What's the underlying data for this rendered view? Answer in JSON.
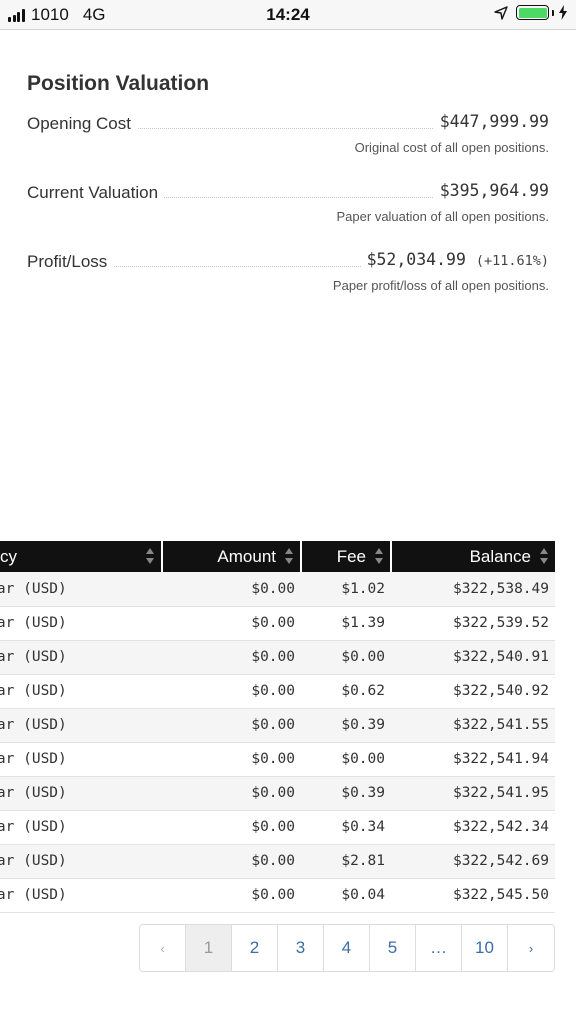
{
  "status_bar": {
    "carrier": "1010",
    "network": "4G",
    "time": "14:24"
  },
  "valuation": {
    "title": "Position Valuation",
    "rows": [
      {
        "label": "Opening Cost",
        "value": "$447,999.99",
        "pct": "",
        "note": "Original cost of all open positions."
      },
      {
        "label": "Current Valuation",
        "value": "$395,964.99",
        "pct": "",
        "note": "Paper valuation of all open positions."
      },
      {
        "label": "Profit/Loss",
        "value": "$52,034.99",
        "pct": "(+11.61%)",
        "note": "Paper profit/loss of all open positions."
      }
    ]
  },
  "table": {
    "headers": [
      "cy",
      "Amount",
      "Fee",
      "Balance"
    ],
    "rows": [
      {
        "currency": "Dollar (USD)",
        "amount": "$0.00",
        "fee": "$1.02",
        "balance": "$322,538.49"
      },
      {
        "currency": "Dollar (USD)",
        "amount": "$0.00",
        "fee": "$1.39",
        "balance": "$322,539.52"
      },
      {
        "currency": "Dollar (USD)",
        "amount": "$0.00",
        "fee": "$0.00",
        "balance": "$322,540.91"
      },
      {
        "currency": "Dollar (USD)",
        "amount": "$0.00",
        "fee": "$0.62",
        "balance": "$322,540.92"
      },
      {
        "currency": "Dollar (USD)",
        "amount": "$0.00",
        "fee": "$0.39",
        "balance": "$322,541.55"
      },
      {
        "currency": "Dollar (USD)",
        "amount": "$0.00",
        "fee": "$0.00",
        "balance": "$322,541.94"
      },
      {
        "currency": "Dollar (USD)",
        "amount": "$0.00",
        "fee": "$0.39",
        "balance": "$322,541.95"
      },
      {
        "currency": "Dollar (USD)",
        "amount": "$0.00",
        "fee": "$0.34",
        "balance": "$322,542.34"
      },
      {
        "currency": "Dollar (USD)",
        "amount": "$0.00",
        "fee": "$2.81",
        "balance": "$322,542.69"
      },
      {
        "currency": "Dollar (USD)",
        "amount": "$0.00",
        "fee": "$0.04",
        "balance": "$322,545.50"
      }
    ]
  },
  "pagination": {
    "prev": "‹",
    "pages": [
      "1",
      "2",
      "3",
      "4",
      "5",
      "…",
      "10"
    ],
    "next": "›",
    "current_page": "1"
  },
  "colors": {
    "header_bg": "#111111",
    "link": "#3b6ea5",
    "battery": "#4cd964"
  },
  "icons": [
    "signal-icon",
    "location-arrow-icon",
    "battery-icon",
    "charging-bolt-icon",
    "sort-icon"
  ]
}
